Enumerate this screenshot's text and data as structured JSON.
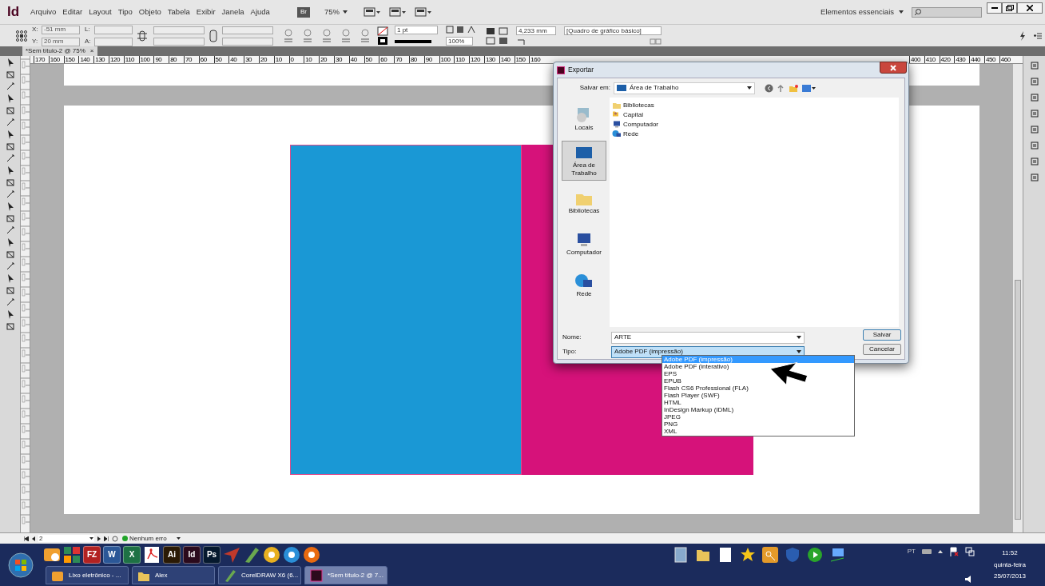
{
  "app": {
    "logo": "Id",
    "menu": [
      "Arquivo",
      "Editar",
      "Layout",
      "Tipo",
      "Objeto",
      "Tabela",
      "Exibir",
      "Janela",
      "Ajuda"
    ],
    "bridge": "Br",
    "zoom": "75%",
    "workspace": "Elementos essenciais"
  },
  "control_panel": {
    "x_label": "X:",
    "x": "-51 mm",
    "y_label": "Y:",
    "y": "20 mm",
    "w_label": "L:",
    "h_label": "A:",
    "stroke_weight": "1 pt",
    "scale": "100%",
    "offset": "4,233 mm",
    "object_style": "[Quadro de gráfico básico]"
  },
  "document_tab": {
    "title": "*Sem título-2 @ 75%",
    "close": "×"
  },
  "ruler": {
    "left_labels": [
      "170",
      "160",
      "150",
      "140",
      "130",
      "120",
      "110",
      "100",
      "90",
      "80",
      "70",
      "60",
      "50",
      "40",
      "30",
      "20",
      "10",
      "0",
      "10",
      "20",
      "30",
      "40",
      "50",
      "60",
      "70",
      "80",
      "90",
      "100",
      "110",
      "120",
      "130",
      "140",
      "150",
      "160"
    ],
    "right_labels": [
      "400",
      "410",
      "420",
      "430",
      "440",
      "450",
      "460"
    ]
  },
  "status_bar": {
    "page": "2",
    "preflight": "Nenhum erro"
  },
  "dialog": {
    "title": "Exportar",
    "save_in_label": "Salvar em:",
    "save_in": "Área de Trabalho",
    "places": [
      {
        "label": "Locais",
        "kind": "recent",
        "selected": false
      },
      {
        "label": "Área de Trabalho",
        "kind": "desktop",
        "selected": true
      },
      {
        "label": "Bibliotecas",
        "kind": "libraries",
        "selected": false
      },
      {
        "label": "Computador",
        "kind": "computer",
        "selected": false
      },
      {
        "label": "Rede",
        "kind": "network",
        "selected": false
      }
    ],
    "files": [
      {
        "label": "Bibliotecas",
        "kind": "libraries"
      },
      {
        "label": "Capital",
        "kind": "user"
      },
      {
        "label": "Computador",
        "kind": "computer"
      },
      {
        "label": "Rede",
        "kind": "network"
      }
    ],
    "name_label": "Nome:",
    "name": "ARTE",
    "type_label": "Tipo:",
    "type": "Adobe PDF (impressão)",
    "buttons": [
      "Salvar",
      "Cancelar"
    ],
    "type_options": [
      {
        "label": "Adobe PDF (impressão)",
        "selected": true
      },
      {
        "label": "Adobe PDF (interativo)",
        "selected": false
      },
      {
        "label": "EPS",
        "selected": false
      },
      {
        "label": "EPUB",
        "selected": false
      },
      {
        "label": "Flash CS6 Professional (FLA)",
        "selected": false
      },
      {
        "label": "Flash Player (SWF)",
        "selected": false
      },
      {
        "label": "HTML",
        "selected": false
      },
      {
        "label": "InDesign Markup (IDML)",
        "selected": false
      },
      {
        "label": "JPEG",
        "selected": false
      },
      {
        "label": "PNG",
        "selected": false
      },
      {
        "label": "XML",
        "selected": false
      }
    ]
  },
  "taskbar": {
    "quick_launch": [
      {
        "kind": "mail",
        "color": "#f0a030"
      },
      {
        "kind": "tiles",
        "color": "#2e8b57"
      },
      {
        "kind": "letters",
        "label": "FZ",
        "color": "#b22222"
      },
      {
        "kind": "letters",
        "label": "W",
        "color": "#2b5797"
      },
      {
        "kind": "letters",
        "label": "X",
        "color": "#1e7145"
      },
      {
        "kind": "pdf",
        "color": "#ffffff"
      },
      {
        "kind": "letters",
        "label": "Ai",
        "color": "#2b1a05"
      },
      {
        "kind": "letters",
        "label": "Id",
        "color": "#2b0a1c"
      },
      {
        "kind": "letters",
        "label": "Ps",
        "color": "#06192e"
      },
      {
        "kind": "arrow",
        "color": "#c0392b"
      },
      {
        "kind": "pen",
        "color": "#6aa84f"
      },
      {
        "kind": "circle",
        "color": "#e8b020"
      },
      {
        "kind": "circle",
        "color": "#2a8fd8"
      },
      {
        "kind": "circle",
        "color": "#e86a10"
      }
    ],
    "tasks": [
      {
        "label": "Lixo eletrônico - ...",
        "kind": "mail",
        "selected": false
      },
      {
        "label": "Alex",
        "kind": "folder",
        "selected": false
      },
      {
        "label": "CorelDRAW X6 (6...",
        "kind": "pen",
        "selected": false
      },
      {
        "label": "*Sem título-2 @ 7...",
        "kind": "indesign",
        "selected": true
      }
    ],
    "language": "PT",
    "time": "11:52",
    "day": "quinta-feira",
    "date": "25/07/2013"
  }
}
